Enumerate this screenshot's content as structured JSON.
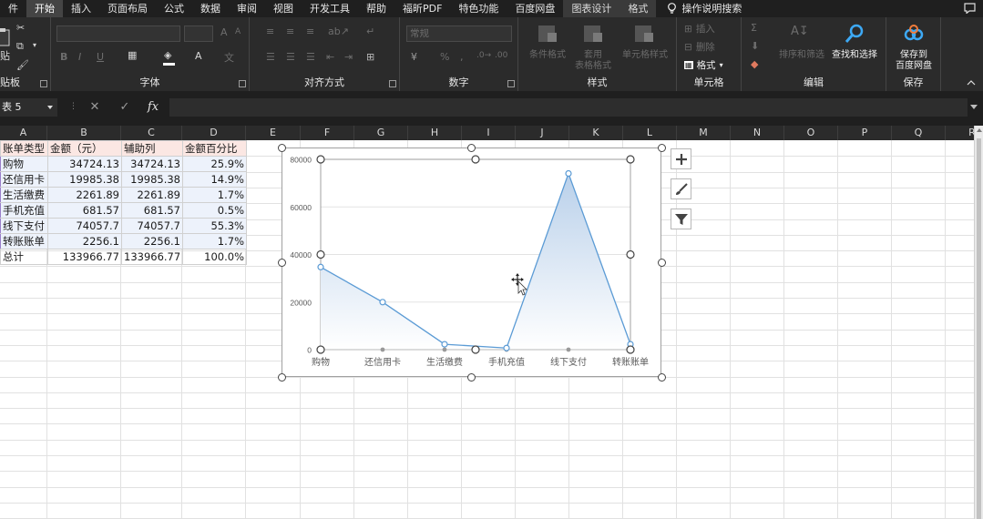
{
  "ribbon_tabs": [
    {
      "label": "件",
      "state": "normal"
    },
    {
      "label": "开始",
      "state": "active"
    },
    {
      "label": "插入",
      "state": "normal"
    },
    {
      "label": "页面布局",
      "state": "normal"
    },
    {
      "label": "公式",
      "state": "normal"
    },
    {
      "label": "数据",
      "state": "normal"
    },
    {
      "label": "审阅",
      "state": "normal"
    },
    {
      "label": "视图",
      "state": "normal"
    },
    {
      "label": "开发工具",
      "state": "normal"
    },
    {
      "label": "帮助",
      "state": "normal"
    },
    {
      "label": "福昕PDF",
      "state": "normal"
    },
    {
      "label": "特色功能",
      "state": "normal"
    },
    {
      "label": "百度网盘",
      "state": "normal"
    },
    {
      "label": "图表设计",
      "state": "contextual"
    },
    {
      "label": "格式",
      "state": "contextual"
    }
  ],
  "help_search_label": "操作说明搜索",
  "ribbon": {
    "clipboard": {
      "label": "贴板",
      "paste_label": "贴"
    },
    "font": {
      "label": "字体",
      "bold": "B",
      "italic": "I",
      "underline": "U",
      "grow": "A",
      "shrink": "A",
      "text_color_letter": "A"
    },
    "alignment": {
      "label": "对齐方式"
    },
    "number": {
      "label": "数字",
      "format": "常规",
      "percent": "%",
      "comma": ","
    },
    "styles": {
      "label": "样式",
      "conditional": "条件格式",
      "table_line1": "套用",
      "table_line2": "表格格式",
      "cell_styles": "单元格样式"
    },
    "cells": {
      "label": "单元格",
      "insert": "插入",
      "delete": "删除",
      "format": "格式"
    },
    "editing": {
      "label": "编辑",
      "sort_filter": "排序和筛选",
      "find_select": "查找和选择",
      "sum": "Σ"
    },
    "save": {
      "label": "保存",
      "save_to_line1": "保存到",
      "save_to_line2": "百度网盘"
    }
  },
  "formula_bar": {
    "name_box": "表 5",
    "cancel": "✕",
    "enter": "✓",
    "fx": "fx",
    "formula": ""
  },
  "columns": [
    "A",
    "B",
    "C",
    "D",
    "E",
    "F",
    "G",
    "H",
    "I",
    "J",
    "K",
    "L",
    "M",
    "N",
    "O",
    "P",
    "Q",
    "R"
  ],
  "table": {
    "headers": [
      "账单类型",
      "金额（元）",
      "辅助列",
      "金额百分比"
    ],
    "rows": [
      [
        "购物",
        "34724.13",
        "34724.13",
        "25.9%"
      ],
      [
        "还信用卡",
        "19985.38",
        "19985.38",
        "14.9%"
      ],
      [
        "生活缴费",
        "2261.89",
        "2261.89",
        "1.7%"
      ],
      [
        "手机充值",
        "681.57",
        "681.57",
        "0.5%"
      ],
      [
        "线下支付",
        "74057.7",
        "74057.7",
        "55.3%"
      ],
      [
        "转账账单",
        "2256.1",
        "2256.1",
        "1.7%"
      ],
      [
        "总计",
        "133966.77",
        "133966.77",
        "100.0%"
      ]
    ]
  },
  "chart_data": {
    "type": "area",
    "categories": [
      "购物",
      "还信用卡",
      "生活缴费",
      "手机充值",
      "线下支付",
      "转账账单"
    ],
    "series": [
      {
        "values": [
          34724.13,
          19985.38,
          2261.89,
          681.57,
          74057.7,
          2256.1
        ],
        "color": "#5b9bd5"
      }
    ],
    "yticks": [
      0,
      20000,
      40000,
      60000,
      80000
    ],
    "ylim": [
      0,
      80000
    ],
    "title": "",
    "legend": "none",
    "grid": true
  },
  "chart_side_buttons": [
    "chart-elements",
    "chart-styles",
    "chart-filters"
  ],
  "accent": "#5b9bd5"
}
